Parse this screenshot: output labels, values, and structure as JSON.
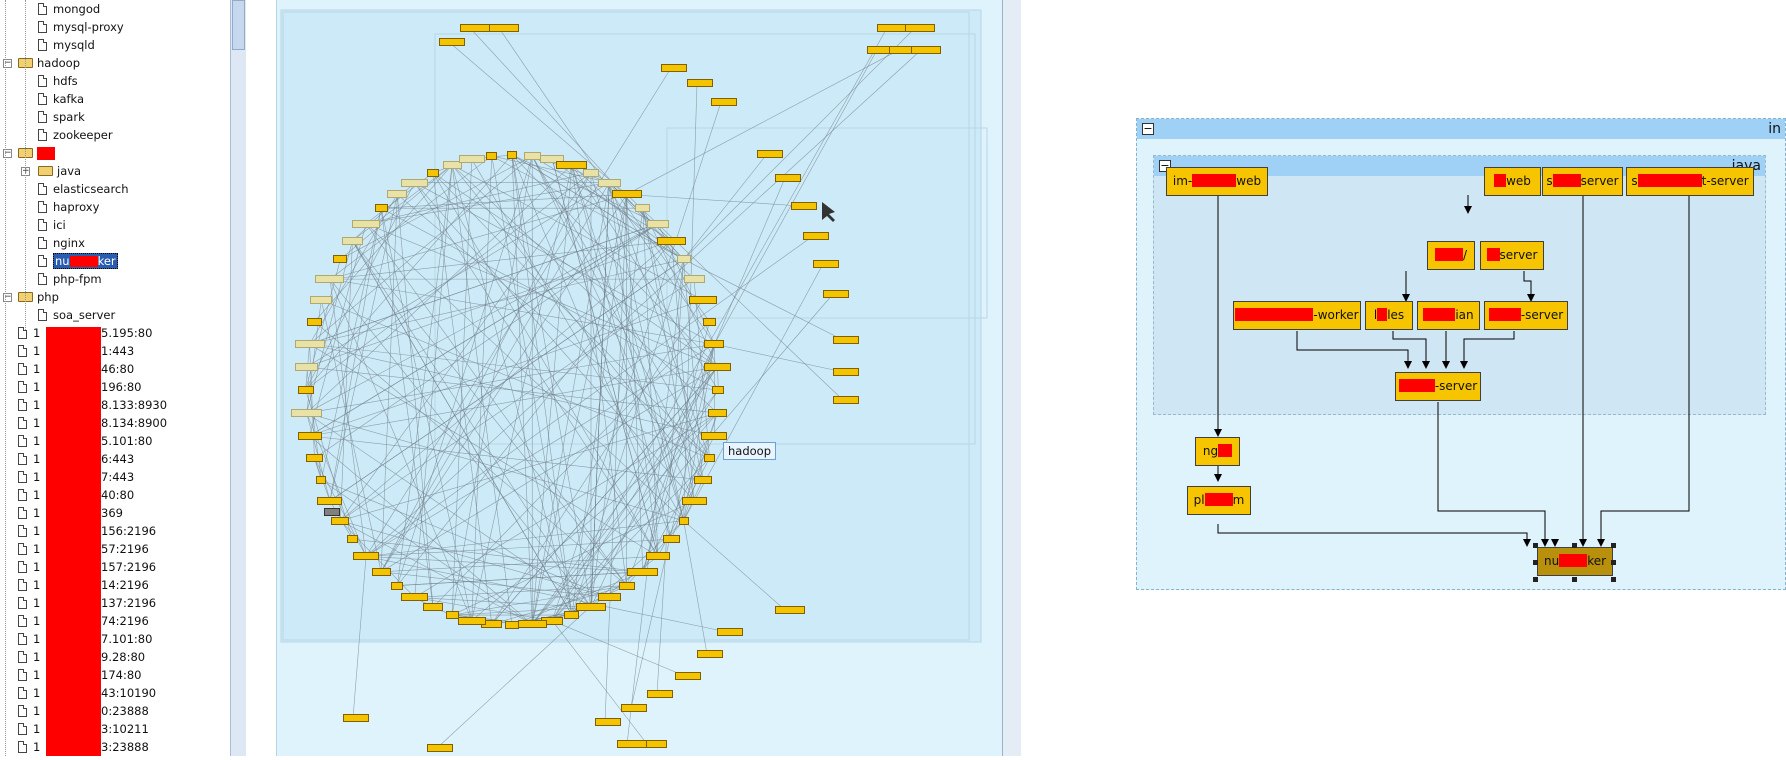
{
  "tree": {
    "items": [
      {
        "type": "file",
        "indent": 2,
        "label": "mongod"
      },
      {
        "type": "file",
        "indent": 2,
        "label": "mysql-proxy"
      },
      {
        "type": "file",
        "indent": 2,
        "label": "mysqld"
      },
      {
        "type": "folder",
        "indent": 1,
        "label": "hadoop",
        "expanded": true
      },
      {
        "type": "file",
        "indent": 2,
        "label": "hdfs"
      },
      {
        "type": "file",
        "indent": 2,
        "label": "kafka"
      },
      {
        "type": "file",
        "indent": 2,
        "label": "spark"
      },
      {
        "type": "file",
        "indent": 2,
        "label": "zookeeper"
      },
      {
        "type": "folder",
        "indent": 1,
        "label": "",
        "redacted": true,
        "expanded": true
      },
      {
        "type": "folder",
        "indent": 2,
        "label": "java",
        "expanded": false
      },
      {
        "type": "file",
        "indent": 2,
        "label": "elasticsearch"
      },
      {
        "type": "file",
        "indent": 2,
        "label": "haproxy"
      },
      {
        "type": "file",
        "indent": 2,
        "label": "ici"
      },
      {
        "type": "file",
        "indent": 2,
        "label": "nginx"
      },
      {
        "type": "file",
        "indent": 2,
        "label": "nu|ker",
        "selected": true
      },
      {
        "type": "file",
        "indent": 2,
        "label": "php-fpm"
      },
      {
        "type": "folder",
        "indent": 1,
        "label": "php",
        "expanded": true
      },
      {
        "type": "file",
        "indent": 2,
        "label": "soa_server"
      }
    ],
    "ip_items": [
      "1",
      "1",
      "1",
      "1",
      "1",
      "1",
      "1",
      "1",
      "1",
      "1",
      "1",
      "1",
      "1",
      "1",
      "1",
      "1",
      "1",
      "1",
      "1",
      "1",
      "1",
      "1",
      "1",
      "1"
    ],
    "ip_suffixes": [
      "5.195:80",
      "1:443",
      "46:80",
      "196:80",
      "8.133:8930",
      "8.134:8900",
      "5.101:80",
      "6:443",
      "7:443",
      "40:80",
      "369",
      "156:2196",
      "57:2196",
      "157:2196",
      "14:2196",
      "137:2196",
      "74:2196",
      "7.101:80",
      "9.28:80",
      "174:80",
      "43:10190",
      "0:23888",
      "3:10211",
      "3:23888"
    ]
  },
  "graph": {
    "tooltip": "hadoop"
  },
  "detail": {
    "outer_group_label": "in",
    "java_group_label": "java",
    "collapse_symbol": "−",
    "nodes": {
      "im_web": {
        "pre": "im-",
        "post": "web"
      },
      "web": {
        "pre": "",
        "post": "web"
      },
      "s_server": {
        "pre": "s",
        "post": "server"
      },
      "st_server": {
        "pre": "s",
        "post": "t-server"
      },
      "slash": {
        "pre": "",
        "post": "/"
      },
      "server2": {
        "pre": "",
        "post": "server"
      },
      "worker": {
        "pre": "",
        "post": "-worker"
      },
      "les": {
        "pre": "l",
        "post": "les"
      },
      "jian": {
        "pre": "",
        "post": "ian"
      },
      "dash_server": {
        "pre": "",
        "post": "-server"
      },
      "center_server": {
        "pre": "",
        "post": "-server"
      },
      "ng": {
        "pre": "ng",
        "post": ""
      },
      "pl_m": {
        "pre": "pl",
        "post": "m"
      },
      "nu_ker": {
        "pre": "nu",
        "post": "ker"
      }
    }
  },
  "colors": {
    "node_fill": "#f7c400",
    "selected_node_fill": "#b8900c",
    "redaction": "#ff0000",
    "group_header": "#9fd0f6"
  }
}
